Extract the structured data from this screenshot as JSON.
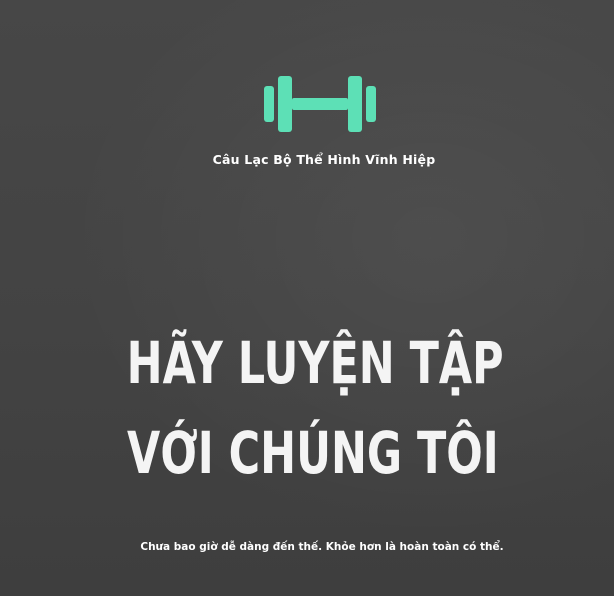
{
  "brand": {
    "logo_icon": "dumbbell-icon",
    "logo_color": "#5de0b6",
    "club_name": "Câu Lạc Bộ Thể Hình Vĩnh Hiệp"
  },
  "hero": {
    "headline_line1": "HÃY LUYỆN TẬP",
    "headline_line2": "VỚI CHÚNG TÔI",
    "tagline": "Chưa bao giờ dễ dàng đến thế. Khỏe hơn là hoàn toàn có thể."
  },
  "colors": {
    "background": "#444444",
    "text": "#ffffff",
    "accent": "#5de0b6"
  }
}
